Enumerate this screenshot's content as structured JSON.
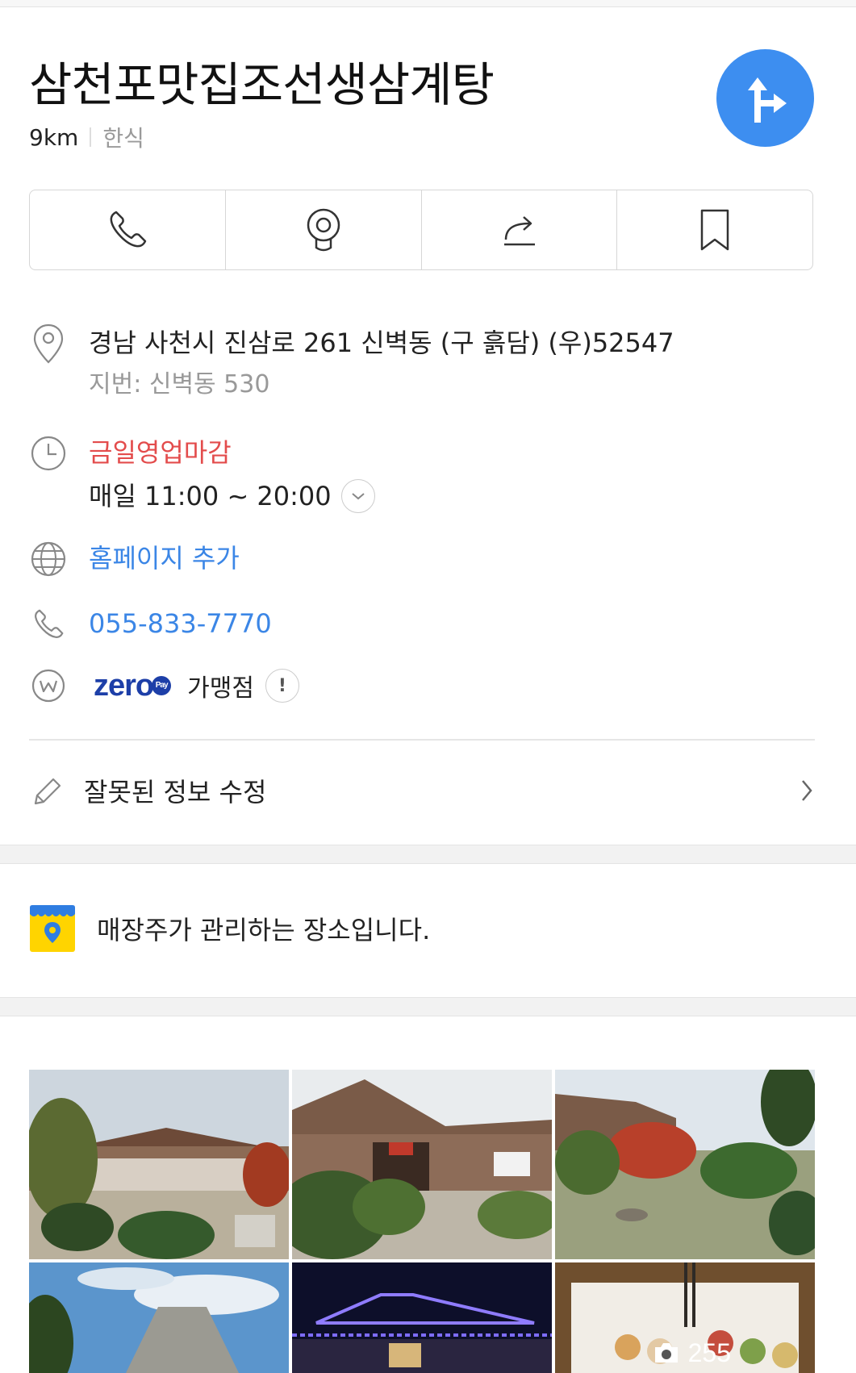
{
  "place": {
    "name": "삼천포맛집조선생삼계탕",
    "distance": "9km",
    "category": "한식"
  },
  "actions": [
    {
      "icon": "phone-icon"
    },
    {
      "icon": "streetview-icon"
    },
    {
      "icon": "share-icon"
    },
    {
      "icon": "bookmark-icon"
    }
  ],
  "address": {
    "road": "경남 사천시 진삼로 261 신벽동 (구 흙담) (우)52547",
    "jibun": "지번: 신벽동 530"
  },
  "hours": {
    "status": "금일영업마감",
    "schedule": "매일 11:00 ~ 20:00"
  },
  "homepage": {
    "label": "홈페이지 추가"
  },
  "phone": {
    "number": "055-833-7770"
  },
  "zeropay": {
    "logo": "zero",
    "pay_mark": "Pay",
    "label": "가맹점",
    "info": "!"
  },
  "edit": {
    "label": "잘못된 정보 수정"
  },
  "owner": {
    "label": "매장주가 관리하는 장소입니다."
  },
  "photos": {
    "count": "255"
  },
  "colors": {
    "accent": "#3d8ef0",
    "link": "#3b86e6",
    "closed": "#e34c4c",
    "zeropay": "#1d3fa8",
    "owner_icon": "#ffd400"
  }
}
